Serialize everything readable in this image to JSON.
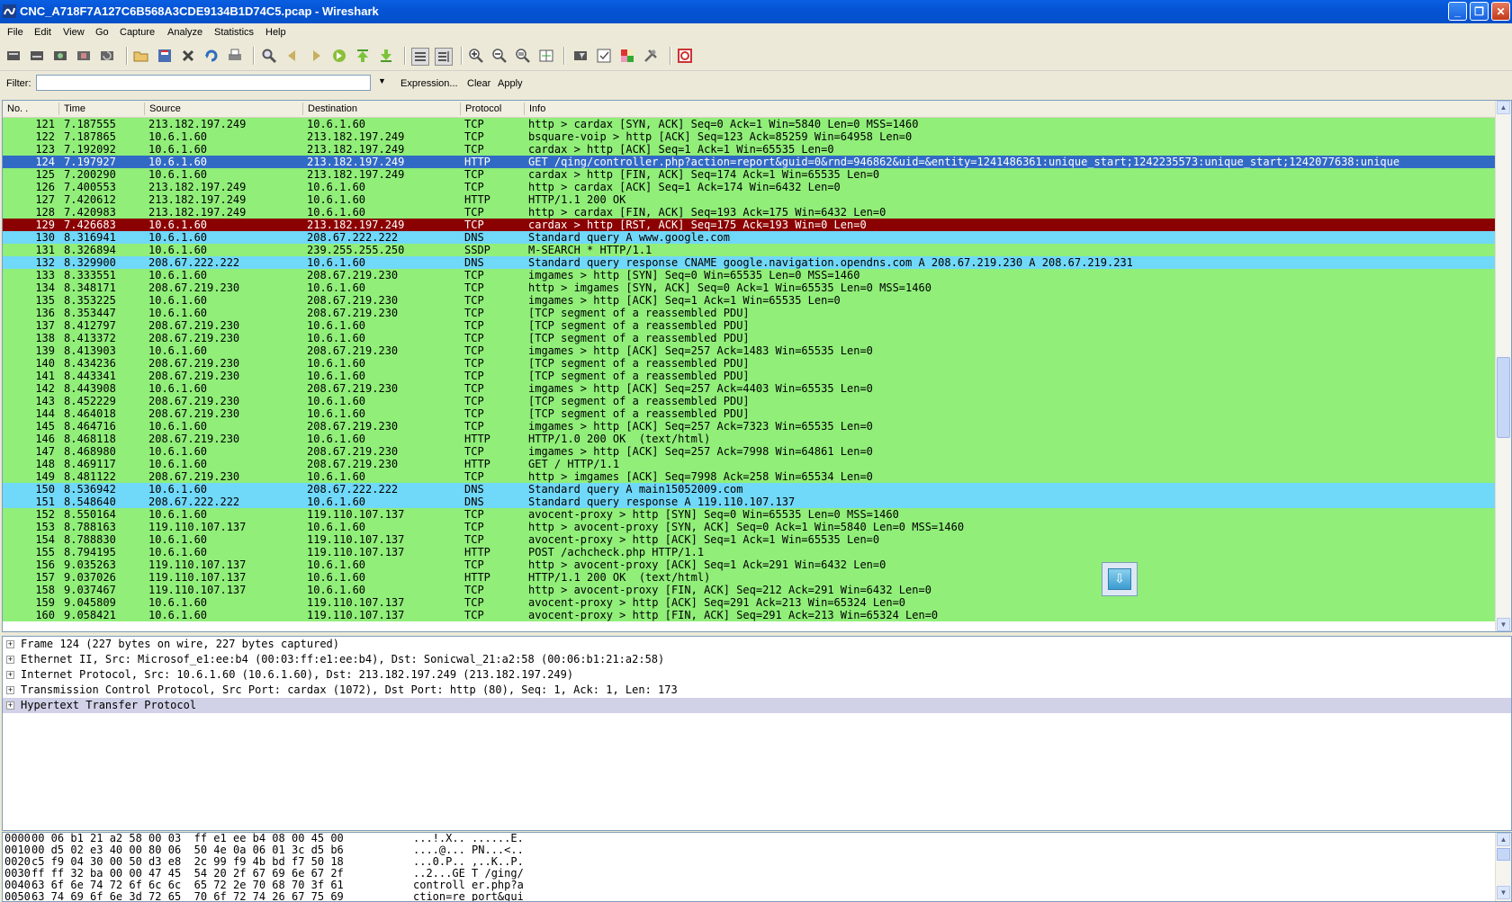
{
  "window": {
    "title": "CNC_A718F7A127C6B568A3CDE9134B1D74C5.pcap - Wireshark",
    "minimize": "_",
    "restore": "❐",
    "close": "✕"
  },
  "menu": [
    "File",
    "Edit",
    "View",
    "Go",
    "Capture",
    "Analyze",
    "Statistics",
    "Help"
  ],
  "toolbar_icons": [
    "interface-list-icon",
    "capture-options-icon",
    "start-capture-icon",
    "stop-capture-icon",
    "restart-capture-icon",
    "open-file-icon",
    "save-file-icon",
    "close-file-icon",
    "reload-icon",
    "print-icon",
    "find-packet-icon",
    "go-back-icon",
    "go-forward-icon",
    "go-to-packet-icon",
    "go-first-icon",
    "go-last-icon",
    "colorize-icon",
    "autoscroll-icon",
    "zoom-in-icon",
    "zoom-out-icon",
    "zoom-normal-icon",
    "resize-columns-icon",
    "capture-filters-icon",
    "display-filters-icon",
    "coloring-rules-icon",
    "preferences-icon",
    "help-icon"
  ],
  "filter": {
    "label": "Filter:",
    "value": "",
    "expression": "Expression...",
    "clear": "Clear",
    "apply": "Apply"
  },
  "columns": {
    "no": "No. .",
    "time": "Time",
    "source": "Source",
    "destination": "Destination",
    "protocol": "Protocol",
    "info": "Info"
  },
  "colors": {
    "tcp": "#90ee79",
    "dns": "#70d8f8",
    "selected": "#316ac5",
    "rst": "#8b0000"
  },
  "packets": [
    {
      "no": "121",
      "time": "7.187555",
      "src": "213.182.197.249",
      "dst": "10.6.1.60",
      "proto": "TCP",
      "info": "http > cardax [SYN, ACK] Seq=0 Ack=1 Win=5840 Len=0 MSS=1460",
      "style": "tcp"
    },
    {
      "no": "122",
      "time": "7.187865",
      "src": "10.6.1.60",
      "dst": "213.182.197.249",
      "proto": "TCP",
      "info": "bsquare-voip > http [ACK] Seq=123 Ack=85259 Win=64958 Len=0",
      "style": "tcp"
    },
    {
      "no": "123",
      "time": "7.192092",
      "src": "10.6.1.60",
      "dst": "213.182.197.249",
      "proto": "TCP",
      "info": "cardax > http [ACK] Seq=1 Ack=1 Win=65535 Len=0",
      "style": "tcp"
    },
    {
      "no": "124",
      "time": "7.197927",
      "src": "10.6.1.60",
      "dst": "213.182.197.249",
      "proto": "HTTP",
      "info": "GET /qing/controller.php?action=report&guid=0&rnd=946862&uid=&entity=1241486361:unique_start;1242235573:unique_start;1242077638:unique",
      "style": "selected"
    },
    {
      "no": "125",
      "time": "7.200290",
      "src": "10.6.1.60",
      "dst": "213.182.197.249",
      "proto": "TCP",
      "info": "cardax > http [FIN, ACK] Seq=174 Ack=1 Win=65535 Len=0",
      "style": "tcp"
    },
    {
      "no": "126",
      "time": "7.400553",
      "src": "213.182.197.249",
      "dst": "10.6.1.60",
      "proto": "TCP",
      "info": "http > cardax [ACK] Seq=1 Ack=174 Win=6432 Len=0",
      "style": "tcp"
    },
    {
      "no": "127",
      "time": "7.420612",
      "src": "213.182.197.249",
      "dst": "10.6.1.60",
      "proto": "HTTP",
      "info": "HTTP/1.1 200 OK",
      "style": "tcp"
    },
    {
      "no": "128",
      "time": "7.420983",
      "src": "213.182.197.249",
      "dst": "10.6.1.60",
      "proto": "TCP",
      "info": "http > cardax [FIN, ACK] Seq=193 Ack=175 Win=6432 Len=0",
      "style": "tcp"
    },
    {
      "no": "129",
      "time": "7.426683",
      "src": "10.6.1.60",
      "dst": "213.182.197.249",
      "proto": "TCP",
      "info": "cardax > http [RST, ACK] Seq=175 Ack=193 Win=0 Len=0",
      "style": "rst"
    },
    {
      "no": "130",
      "time": "8.316941",
      "src": "10.6.1.60",
      "dst": "208.67.222.222",
      "proto": "DNS",
      "info": "Standard query A www.google.com",
      "style": "dns"
    },
    {
      "no": "131",
      "time": "8.326894",
      "src": "10.6.1.60",
      "dst": "239.255.255.250",
      "proto": "SSDP",
      "info": "M-SEARCH * HTTP/1.1",
      "style": "tcp"
    },
    {
      "no": "132",
      "time": "8.329900",
      "src": "208.67.222.222",
      "dst": "10.6.1.60",
      "proto": "DNS",
      "info": "Standard query response CNAME google.navigation.opendns.com A 208.67.219.230 A 208.67.219.231",
      "style": "dns"
    },
    {
      "no": "133",
      "time": "8.333551",
      "src": "10.6.1.60",
      "dst": "208.67.219.230",
      "proto": "TCP",
      "info": "imgames > http [SYN] Seq=0 Win=65535 Len=0 MSS=1460",
      "style": "tcp"
    },
    {
      "no": "134",
      "time": "8.348171",
      "src": "208.67.219.230",
      "dst": "10.6.1.60",
      "proto": "TCP",
      "info": "http > imgames [SYN, ACK] Seq=0 Ack=1 Win=65535 Len=0 MSS=1460",
      "style": "tcp"
    },
    {
      "no": "135",
      "time": "8.353225",
      "src": "10.6.1.60",
      "dst": "208.67.219.230",
      "proto": "TCP",
      "info": "imgames > http [ACK] Seq=1 Ack=1 Win=65535 Len=0",
      "style": "tcp"
    },
    {
      "no": "136",
      "time": "8.353447",
      "src": "10.6.1.60",
      "dst": "208.67.219.230",
      "proto": "TCP",
      "info": "[TCP segment of a reassembled PDU]",
      "style": "tcp"
    },
    {
      "no": "137",
      "time": "8.412797",
      "src": "208.67.219.230",
      "dst": "10.6.1.60",
      "proto": "TCP",
      "info": "[TCP segment of a reassembled PDU]",
      "style": "tcp"
    },
    {
      "no": "138",
      "time": "8.413372",
      "src": "208.67.219.230",
      "dst": "10.6.1.60",
      "proto": "TCP",
      "info": "[TCP segment of a reassembled PDU]",
      "style": "tcp"
    },
    {
      "no": "139",
      "time": "8.413903",
      "src": "10.6.1.60",
      "dst": "208.67.219.230",
      "proto": "TCP",
      "info": "imgames > http [ACK] Seq=257 Ack=1483 Win=65535 Len=0",
      "style": "tcp"
    },
    {
      "no": "140",
      "time": "8.434236",
      "src": "208.67.219.230",
      "dst": "10.6.1.60",
      "proto": "TCP",
      "info": "[TCP segment of a reassembled PDU]",
      "style": "tcp"
    },
    {
      "no": "141",
      "time": "8.443341",
      "src": "208.67.219.230",
      "dst": "10.6.1.60",
      "proto": "TCP",
      "info": "[TCP segment of a reassembled PDU]",
      "style": "tcp"
    },
    {
      "no": "142",
      "time": "8.443908",
      "src": "10.6.1.60",
      "dst": "208.67.219.230",
      "proto": "TCP",
      "info": "imgames > http [ACK] Seq=257 Ack=4403 Win=65535 Len=0",
      "style": "tcp"
    },
    {
      "no": "143",
      "time": "8.452229",
      "src": "208.67.219.230",
      "dst": "10.6.1.60",
      "proto": "TCP",
      "info": "[TCP segment of a reassembled PDU]",
      "style": "tcp"
    },
    {
      "no": "144",
      "time": "8.464018",
      "src": "208.67.219.230",
      "dst": "10.6.1.60",
      "proto": "TCP",
      "info": "[TCP segment of a reassembled PDU]",
      "style": "tcp"
    },
    {
      "no": "145",
      "time": "8.464716",
      "src": "10.6.1.60",
      "dst": "208.67.219.230",
      "proto": "TCP",
      "info": "imgames > http [ACK] Seq=257 Ack=7323 Win=65535 Len=0",
      "style": "tcp"
    },
    {
      "no": "146",
      "time": "8.468118",
      "src": "208.67.219.230",
      "dst": "10.6.1.60",
      "proto": "HTTP",
      "info": "HTTP/1.0 200 OK  (text/html)",
      "style": "tcp"
    },
    {
      "no": "147",
      "time": "8.468980",
      "src": "10.6.1.60",
      "dst": "208.67.219.230",
      "proto": "TCP",
      "info": "imgames > http [ACK] Seq=257 Ack=7998 Win=64861 Len=0",
      "style": "tcp"
    },
    {
      "no": "148",
      "time": "8.469117",
      "src": "10.6.1.60",
      "dst": "208.67.219.230",
      "proto": "HTTP",
      "info": "GET / HTTP/1.1",
      "style": "tcp"
    },
    {
      "no": "149",
      "time": "8.481122",
      "src": "208.67.219.230",
      "dst": "10.6.1.60",
      "proto": "TCP",
      "info": "http > imgames [ACK] Seq=7998 Ack=258 Win=65534 Len=0",
      "style": "tcp"
    },
    {
      "no": "150",
      "time": "8.536942",
      "src": "10.6.1.60",
      "dst": "208.67.222.222",
      "proto": "DNS",
      "info": "Standard query A main15052009.com",
      "style": "dns"
    },
    {
      "no": "151",
      "time": "8.548640",
      "src": "208.67.222.222",
      "dst": "10.6.1.60",
      "proto": "DNS",
      "info": "Standard query response A 119.110.107.137",
      "style": "dns"
    },
    {
      "no": "152",
      "time": "8.550164",
      "src": "10.6.1.60",
      "dst": "119.110.107.137",
      "proto": "TCP",
      "info": "avocent-proxy > http [SYN] Seq=0 Win=65535 Len=0 MSS=1460",
      "style": "tcp"
    },
    {
      "no": "153",
      "time": "8.788163",
      "src": "119.110.107.137",
      "dst": "10.6.1.60",
      "proto": "TCP",
      "info": "http > avocent-proxy [SYN, ACK] Seq=0 Ack=1 Win=5840 Len=0 MSS=1460",
      "style": "tcp"
    },
    {
      "no": "154",
      "time": "8.788830",
      "src": "10.6.1.60",
      "dst": "119.110.107.137",
      "proto": "TCP",
      "info": "avocent-proxy > http [ACK] Seq=1 Ack=1 Win=65535 Len=0",
      "style": "tcp"
    },
    {
      "no": "155",
      "time": "8.794195",
      "src": "10.6.1.60",
      "dst": "119.110.107.137",
      "proto": "HTTP",
      "info": "POST /achcheck.php HTTP/1.1",
      "style": "tcp"
    },
    {
      "no": "156",
      "time": "9.035263",
      "src": "119.110.107.137",
      "dst": "10.6.1.60",
      "proto": "TCP",
      "info": "http > avocent-proxy [ACK] Seq=1 Ack=291 Win=6432 Len=0",
      "style": "tcp"
    },
    {
      "no": "157",
      "time": "9.037026",
      "src": "119.110.107.137",
      "dst": "10.6.1.60",
      "proto": "HTTP",
      "info": "HTTP/1.1 200 OK  (text/html)",
      "style": "tcp"
    },
    {
      "no": "158",
      "time": "9.037467",
      "src": "119.110.107.137",
      "dst": "10.6.1.60",
      "proto": "TCP",
      "info": "http > avocent-proxy [FIN, ACK] Seq=212 Ack=291 Win=6432 Len=0",
      "style": "tcp"
    },
    {
      "no": "159",
      "time": "9.045809",
      "src": "10.6.1.60",
      "dst": "119.110.107.137",
      "proto": "TCP",
      "info": "avocent-proxy > http [ACK] Seq=291 Ack=213 Win=65324 Len=0",
      "style": "tcp"
    },
    {
      "no": "160",
      "time": "9.058421",
      "src": "10.6.1.60",
      "dst": "119.110.107.137",
      "proto": "TCP",
      "info": "avocent-proxy > http [FIN, ACK] Seq=291 Ack=213 Win=65324 Len=0",
      "style": "tcp"
    }
  ],
  "detail": [
    {
      "text": "Frame 124 (227 bytes on wire, 227 bytes captured)",
      "selected": false
    },
    {
      "text": "Ethernet II, Src: Microsof_e1:ee:b4 (00:03:ff:e1:ee:b4), Dst: Sonicwal_21:a2:58 (00:06:b1:21:a2:58)",
      "selected": false
    },
    {
      "text": "Internet Protocol, Src: 10.6.1.60 (10.6.1.60), Dst: 213.182.197.249 (213.182.197.249)",
      "selected": false
    },
    {
      "text": "Transmission Control Protocol, Src Port: cardax (1072), Dst Port: http (80), Seq: 1, Ack: 1, Len: 173",
      "selected": false
    },
    {
      "text": "Hypertext Transfer Protocol",
      "selected": true
    }
  ],
  "expand_glyph": "+",
  "hex": [
    {
      "off": "0000",
      "bytes": "00 06 b1 21 a2 58 00 03  ff e1 ee b4 08 00 45 00",
      "ascii": "...!.X.. ......E."
    },
    {
      "off": "0010",
      "bytes": "00 d5 02 e3 40 00 80 06  50 4e 0a 06 01 3c d5 b6",
      "ascii": "....@... PN...<.."
    },
    {
      "off": "0020",
      "bytes": "c5 f9 04 30 00 50 d3 e8  2c 99 f9 4b bd f7 50 18",
      "ascii": "...0.P.. ,..K..P."
    },
    {
      "off": "0030",
      "bytes": "ff ff 32 ba 00 00 47 45  54 20 2f 67 69 6e 67 2f",
      "ascii": "..2...GE T /ging/"
    },
    {
      "off": "0040",
      "bytes": "63 6f 6e 74 72 6f 6c 6c  65 72 2e 70 68 70 3f 61",
      "ascii": "controll er.php?a"
    },
    {
      "off": "0050",
      "bytes": "63 74 69 6f 6e 3d 72 65  70 6f 72 74 26 67 75 69",
      "ascii": "ction=re port&gui"
    }
  ]
}
